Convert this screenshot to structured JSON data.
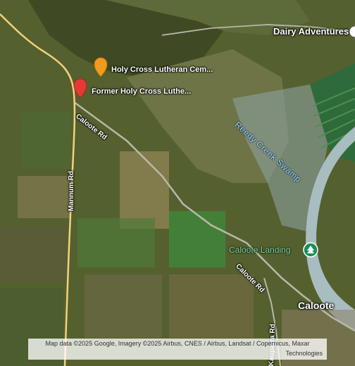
{
  "map": {
    "colors": {
      "farmland": "#55602f",
      "dark_farmland": "#3f4a24",
      "light_field": "#9b8b5c",
      "green_field": "#4f7a3a",
      "bright_green": "#3f8a3f",
      "water": "#8fa6a8",
      "river": "#a7bdc0",
      "main_road": "#f2d27a",
      "minor_road": "#b8b8a8",
      "marker_orange": "#f29a1e",
      "marker_red": "#e53935",
      "landing_icon": "#1e8e5a"
    },
    "markers": [
      {
        "name": "Holy Cross Lutheran Cem...",
        "color": "orange",
        "icon": "map-pin-icon"
      },
      {
        "name": "Former Holy Cross Luthe...",
        "color": "red",
        "icon": "map-pin-icon"
      }
    ],
    "pois": [
      {
        "name": "Dairy Adventures",
        "icon": "location-circle-icon"
      },
      {
        "name": "Caloote Landing",
        "icon": "park-tree-icon"
      }
    ],
    "roads": [
      {
        "name": "Caloote Rd"
      },
      {
        "name": "Mannum Rd"
      },
      {
        "name": "Caloote Rd"
      },
      {
        "name": "Kauparra Rd"
      }
    ],
    "places": [
      {
        "name": "Caloote"
      }
    ],
    "water_features": [
      {
        "name": "Reedy Creek Swamp"
      }
    ]
  },
  "attribution": {
    "line1": "Map data ©2025 Google, Imagery ©2025 Airbus, CNES / Airbus, Landsat / Copernicus, Maxar",
    "line2": "Technologies"
  }
}
